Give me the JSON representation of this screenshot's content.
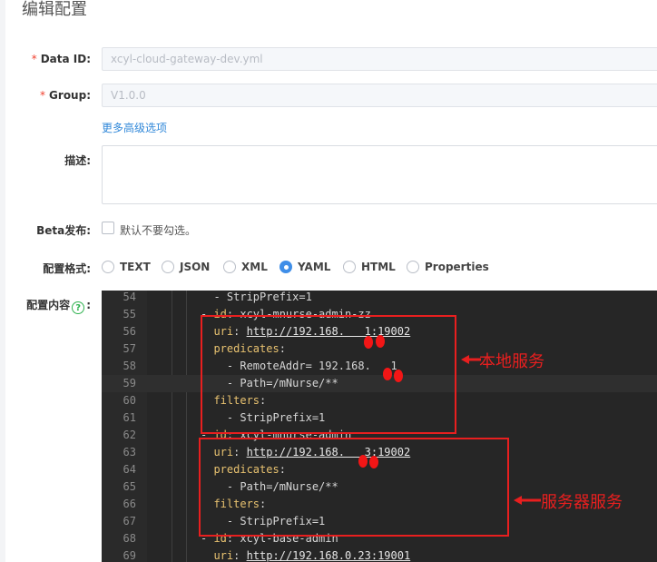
{
  "page": {
    "title": "编辑配置"
  },
  "form": {
    "required_mark": "*",
    "data_id_label": "Data ID:",
    "data_id_value": "xcyl-cloud-gateway-dev.yml",
    "group_label": "Group:",
    "group_value": "V1.0.0",
    "advanced_link": "更多高级选项",
    "desc_label": "描述:",
    "beta_label": "Beta发布:",
    "beta_text": "默认不要勾选。",
    "format_label": "配置格式:",
    "formats": [
      {
        "label": "TEXT",
        "selected": false
      },
      {
        "label": "JSON",
        "selected": false
      },
      {
        "label": "XML",
        "selected": false
      },
      {
        "label": "YAML",
        "selected": true
      },
      {
        "label": "HTML",
        "selected": false
      },
      {
        "label": "Properties",
        "selected": false
      }
    ],
    "content_label": "配置内容",
    "content_help_glyph": "?",
    "content_colon": ":"
  },
  "editor": {
    "lines": [
      {
        "n": "54",
        "indent": "  ",
        "parts": [
          [
            "p",
            "- StripPrefix=1"
          ]
        ]
      },
      {
        "n": "55",
        "indent": "",
        "parts": [
          [
            "p",
            "- "
          ],
          [
            "k",
            "id"
          ],
          [
            "p",
            ": xcyl-mnurse-admin-zz"
          ]
        ]
      },
      {
        "n": "56",
        "indent": "  ",
        "parts": [
          [
            "k",
            "uri"
          ],
          [
            "p",
            ": "
          ],
          [
            "u",
            "http://192.168.   1:19002"
          ]
        ]
      },
      {
        "n": "57",
        "indent": "  ",
        "parts": [
          [
            "k",
            "predicates"
          ],
          [
            "p",
            ":"
          ]
        ]
      },
      {
        "n": "58",
        "indent": "    ",
        "parts": [
          [
            "p",
            "- RemoteAddr= 192.168.   1"
          ]
        ]
      },
      {
        "n": "59",
        "indent": "    ",
        "parts": [
          [
            "p",
            "- Path=/mNurse/**"
          ]
        ]
      },
      {
        "n": "60",
        "indent": "  ",
        "parts": [
          [
            "k",
            "filters"
          ],
          [
            "p",
            ":"
          ]
        ]
      },
      {
        "n": "61",
        "indent": "    ",
        "parts": [
          [
            "p",
            "- StripPrefix=1"
          ]
        ]
      },
      {
        "n": "62",
        "indent": "",
        "parts": [
          [
            "p",
            "- "
          ],
          [
            "k",
            "id"
          ],
          [
            "p",
            ": xcyl-mnurse-admin"
          ]
        ]
      },
      {
        "n": "63",
        "indent": "  ",
        "parts": [
          [
            "k",
            "uri"
          ],
          [
            "p",
            ": "
          ],
          [
            "u",
            "http://192.168.   3:19002"
          ]
        ]
      },
      {
        "n": "64",
        "indent": "  ",
        "parts": [
          [
            "k",
            "predicates"
          ],
          [
            "p",
            ":"
          ]
        ]
      },
      {
        "n": "65",
        "indent": "    ",
        "parts": [
          [
            "p",
            "- Path=/mNurse/**"
          ]
        ]
      },
      {
        "n": "66",
        "indent": "  ",
        "parts": [
          [
            "k",
            "filters"
          ],
          [
            "p",
            ":"
          ]
        ]
      },
      {
        "n": "67",
        "indent": "    ",
        "parts": [
          [
            "p",
            "- StripPrefix=1"
          ]
        ]
      },
      {
        "n": "68",
        "indent": "",
        "parts": [
          [
            "p",
            "- "
          ],
          [
            "k",
            "id"
          ],
          [
            "p",
            ": xcyl-base-admin"
          ]
        ]
      },
      {
        "n": "69",
        "indent": "  ",
        "parts": [
          [
            "k",
            "uri"
          ],
          [
            "p",
            ": "
          ],
          [
            "u",
            "http://192.168.0.23:19001"
          ]
        ]
      }
    ]
  },
  "annotations": {
    "local_label": "本地服务",
    "server_label": "服务器服务",
    "color": "#e81f1f"
  }
}
